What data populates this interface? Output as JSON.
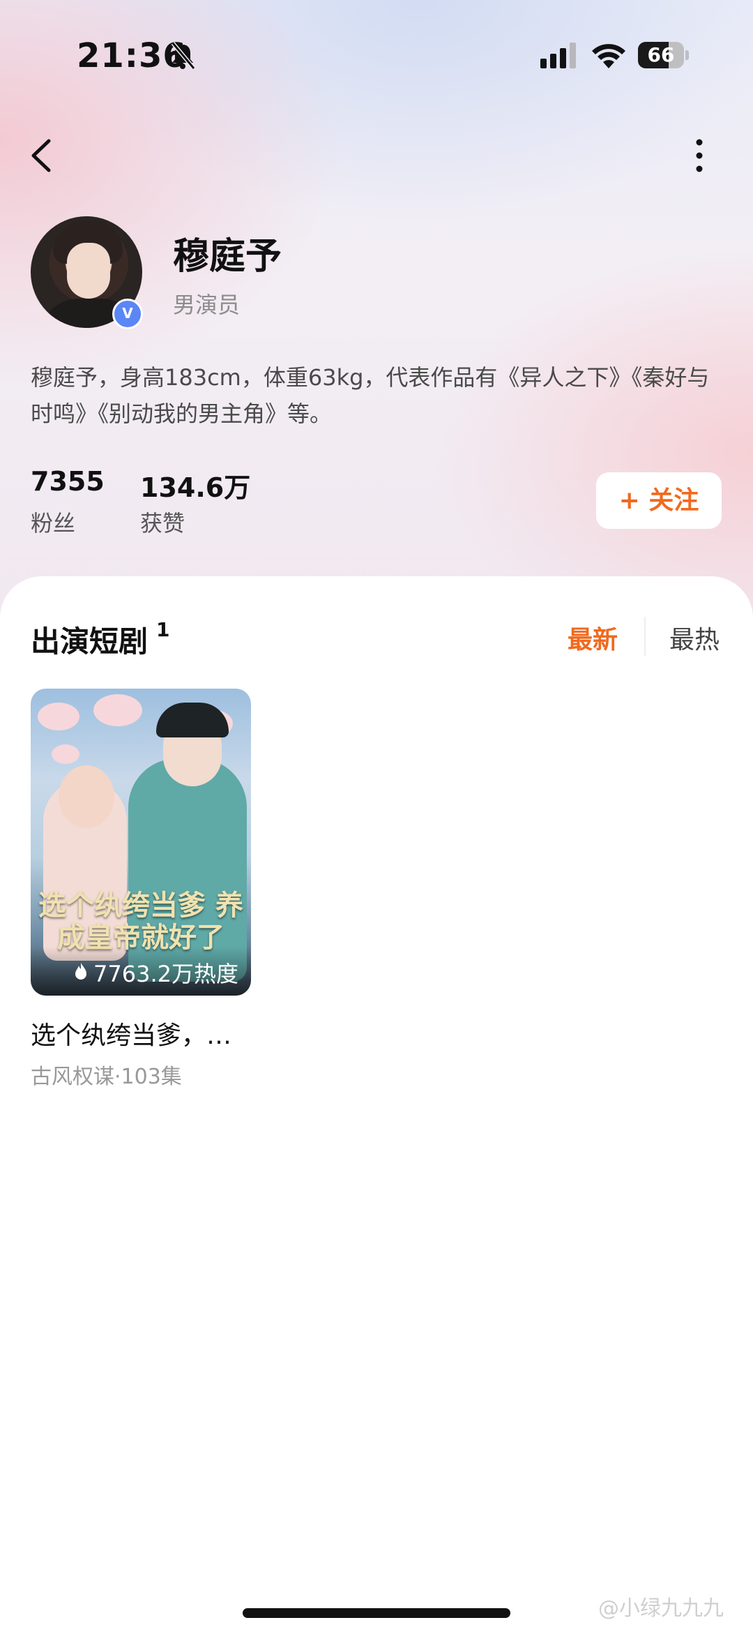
{
  "status_bar": {
    "time": "21:36",
    "battery": "66",
    "battery_level": 0.66
  },
  "profile": {
    "name": "穆庭予",
    "role": "男演员",
    "verified_badge": "V",
    "bio": "穆庭予，身高183cm，体重63kg，代表作品有《异人之下》《秦好与时鸣》《别动我的男主角》等。",
    "stats": [
      {
        "value": "7355",
        "label": "粉丝"
      },
      {
        "value": "134.6万",
        "label": "获赞"
      }
    ],
    "follow_label": "+ 关注"
  },
  "dramas_section": {
    "title": "出演短剧",
    "count": "1",
    "sort_options": [
      "最新",
      "最热"
    ],
    "active_sort": "最新",
    "items": [
      {
        "cover_title": "选个纨绔当爹 养成皇帝就好了",
        "heat": "7763.2万热度",
        "title": "选个纨绔当爹，…",
        "meta": "古风权谋·103集"
      }
    ]
  },
  "watermark": "@小绿九九九",
  "colors": {
    "accent": "#f06a1f",
    "verified": "#5b86f5"
  }
}
